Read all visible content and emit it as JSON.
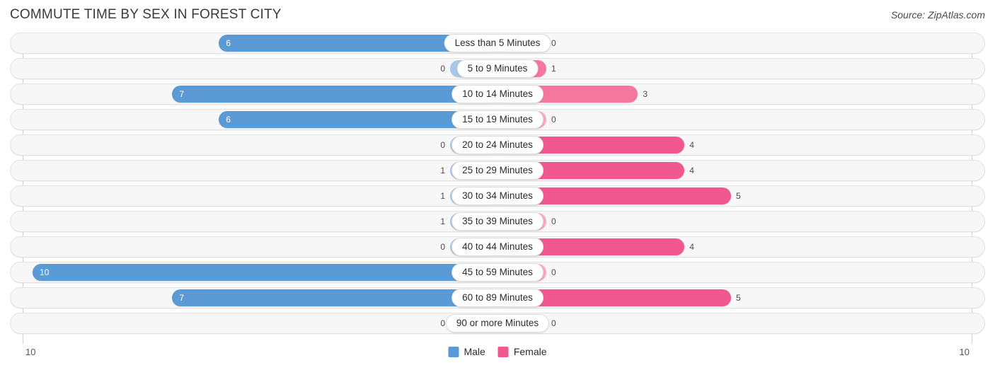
{
  "header": {
    "title": "COMMUTE TIME BY SEX IN FOREST CITY",
    "source": "Source: ZipAtlas.com"
  },
  "legend": {
    "position": "bottom-center",
    "items": [
      {
        "label": "Male",
        "color": "#5b9bd5"
      },
      {
        "label": "Female",
        "color": "#f0588f"
      }
    ]
  },
  "axis": {
    "left_tick": "10",
    "right_tick": "10",
    "max": 10
  },
  "colors": {
    "male_strong": "#5b9bd5",
    "male_light": "#a8c8ea",
    "female_strong": "#f0588f",
    "female_mid": "#f4779f",
    "female_light": "#f9a8c4",
    "row_track": "#f7f7f7",
    "row_border": "#e3e3e3",
    "pill_bg": "#ffffff",
    "axis_line": "#d0d0d0"
  },
  "chart_data": {
    "type": "bar",
    "title": "COMMUTE TIME BY SEX IN FOREST CITY",
    "subtitle": "",
    "xlabel": "",
    "ylabel": "",
    "orientation": "horizontal-diverging",
    "xlim": [
      10,
      10
    ],
    "grid": false,
    "legend_position": "bottom-center",
    "categories": [
      "Less than 5 Minutes",
      "5 to 9 Minutes",
      "10 to 14 Minutes",
      "15 to 19 Minutes",
      "20 to 24 Minutes",
      "25 to 29 Minutes",
      "30 to 34 Minutes",
      "35 to 39 Minutes",
      "40 to 44 Minutes",
      "45 to 59 Minutes",
      "60 to 89 Minutes",
      "90 or more Minutes"
    ],
    "series": [
      {
        "name": "Male",
        "color": "#5b9bd5",
        "values": [
          6,
          0,
          7,
          6,
          0,
          1,
          1,
          1,
          0,
          10,
          7,
          0
        ]
      },
      {
        "name": "Female",
        "color": "#f0588f",
        "values": [
          0,
          1,
          3,
          0,
          4,
          4,
          5,
          0,
          4,
          0,
          5,
          0
        ]
      }
    ]
  },
  "rows": [
    {
      "category": "Less than 5 Minutes",
      "male": "6",
      "female": "0",
      "male_value": 6,
      "female_value": 0
    },
    {
      "category": "5 to 9 Minutes",
      "male": "0",
      "female": "1",
      "male_value": 0,
      "female_value": 1
    },
    {
      "category": "10 to 14 Minutes",
      "male": "7",
      "female": "3",
      "male_value": 7,
      "female_value": 3
    },
    {
      "category": "15 to 19 Minutes",
      "male": "6",
      "female": "0",
      "male_value": 6,
      "female_value": 0
    },
    {
      "category": "20 to 24 Minutes",
      "male": "0",
      "female": "4",
      "male_value": 0,
      "female_value": 4
    },
    {
      "category": "25 to 29 Minutes",
      "male": "1",
      "female": "4",
      "male_value": 1,
      "female_value": 4
    },
    {
      "category": "30 to 34 Minutes",
      "male": "1",
      "female": "5",
      "male_value": 1,
      "female_value": 5
    },
    {
      "category": "35 to 39 Minutes",
      "male": "1",
      "female": "0",
      "male_value": 1,
      "female_value": 0
    },
    {
      "category": "40 to 44 Minutes",
      "male": "0",
      "female": "4",
      "male_value": 0,
      "female_value": 4
    },
    {
      "category": "45 to 59 Minutes",
      "male": "10",
      "female": "0",
      "male_value": 10,
      "female_value": 0
    },
    {
      "category": "60 to 89 Minutes",
      "male": "7",
      "female": "5",
      "male_value": 7,
      "female_value": 5
    },
    {
      "category": "90 or more Minutes",
      "male": "0",
      "female": "0",
      "male_value": 0,
      "female_value": 0
    }
  ]
}
